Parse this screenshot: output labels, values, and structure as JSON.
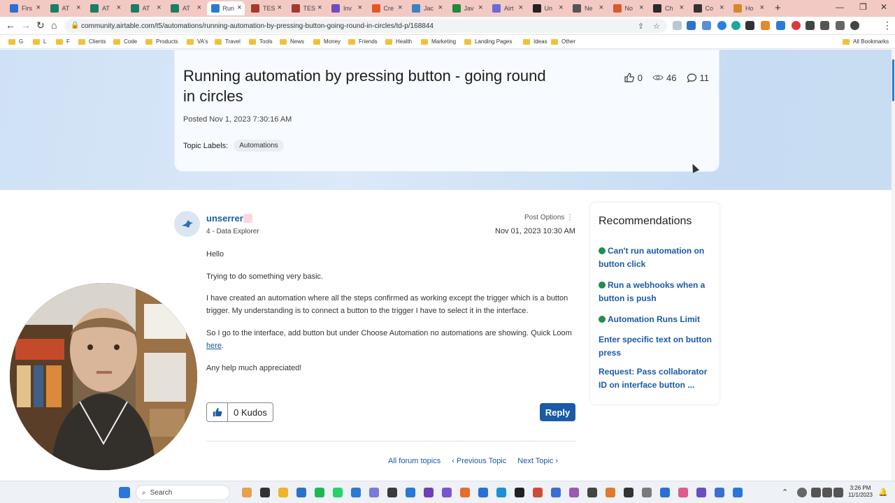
{
  "browser": {
    "tabs": [
      {
        "label": "Firs",
        "icon_color": "#2b6fd6",
        "icon": "fx-icon"
      },
      {
        "label": "AT",
        "icon_color": "#1a7f64",
        "icon": "at-icon"
      },
      {
        "label": "AT",
        "icon_color": "#1a7f64",
        "icon": "at-icon"
      },
      {
        "label": "AT",
        "icon_color": "#1a7f64",
        "icon": "at-icon"
      },
      {
        "label": "AT",
        "icon_color": "#1a7f64",
        "icon": "at-icon"
      },
      {
        "label": "Run",
        "icon_color": "#2d7bd0",
        "icon": "airtable-icon",
        "active": true
      },
      {
        "label": "TES",
        "icon_color": "#a33a2e",
        "icon": "te-icon"
      },
      {
        "label": "TES",
        "icon_color": "#a33a2e",
        "icon": "te-icon"
      },
      {
        "label": "Inv",
        "icon_color": "#6b4fbb",
        "icon": "s-icon"
      },
      {
        "label": "Cre",
        "icon_color": "#e2572a",
        "icon": "c-icon"
      },
      {
        "label": "Jac",
        "icon_color": "#3b82c4",
        "icon": "ja-icon"
      },
      {
        "label": "Jav",
        "icon_color": "#1e8a3b",
        "icon": "w-icon"
      },
      {
        "label": "Airt",
        "icon_color": "#6a6ad8",
        "icon": "gear-icon"
      },
      {
        "label": "Un",
        "icon_color": "#222222",
        "icon": "box-icon"
      },
      {
        "label": "Ne",
        "icon_color": "#555555",
        "icon": "globe-icon"
      },
      {
        "label": "No",
        "icon_color": "#d65b2a",
        "icon": "no-icon"
      },
      {
        "label": "Ch",
        "icon_color": "#2a2a2a",
        "icon": "chat-icon"
      },
      {
        "label": "Co",
        "icon_color": "#333333",
        "icon": "w-icon"
      },
      {
        "label": "Ho",
        "icon_color": "#d08a2a",
        "icon": "ho-icon"
      }
    ],
    "url": "community.airtable.com/t5/automations/running-automation-by-pressing-button-going-round-in-circles/td-p/168844",
    "bookmarks": [
      "G",
      "L",
      "F",
      "Clients",
      "Code",
      "Products",
      "VA's",
      "Travel",
      "Tools",
      "News",
      "Money",
      "Friends",
      "Health",
      "Marketing",
      "Landing Pages",
      "Ideas",
      "Other"
    ],
    "all_bookmarks": "All Bookmarks"
  },
  "topic": {
    "title": "Running automation by pressing button - going round in circles",
    "likes": "0",
    "views": "46",
    "replies": "11",
    "posted": "Posted Nov 1, 2023 7:30:16 AM",
    "labels_prefix": "Topic Labels:",
    "label": "Automations"
  },
  "post": {
    "author": "unserrer",
    "rank": "4 - Data Explorer",
    "options": "Post Options",
    "date": "Nov 01, 2023 10:30 AM",
    "p1": "Hello",
    "p2": "Trying to do something very basic.",
    "p3": "I have created an automation where all the steps confirmed as working except the trigger which is a button trigger. My understanding is to connect a button to the trigger I have to select it in the interface.",
    "p4a": "So I go to the interface, add button but under Choose Automation no automations are showing. Quick Loom",
    "p4link": "here",
    "p4b": ".",
    "p5": "Any help much appreciated!",
    "kudos": "0 Kudos",
    "reply": "Reply"
  },
  "nav": {
    "all": "All forum topics",
    "prev": "‹ Previous Topic",
    "next": "Next Topic ›"
  },
  "recommendations": {
    "title": "Recommendations",
    "items": [
      {
        "label": "Can't run automation on button click",
        "solved": true
      },
      {
        "label": "Run a webhooks when a button is push",
        "solved": true
      },
      {
        "label": "Automation Runs Limit",
        "solved": true
      },
      {
        "label": "Enter specific text on button press",
        "solved": false
      },
      {
        "label": "Request: Pass collaborator ID on interface button ...",
        "solved": false
      }
    ]
  },
  "taskbar": {
    "search": "Search",
    "time": "3:26 PM",
    "date": "11/1/2023"
  }
}
